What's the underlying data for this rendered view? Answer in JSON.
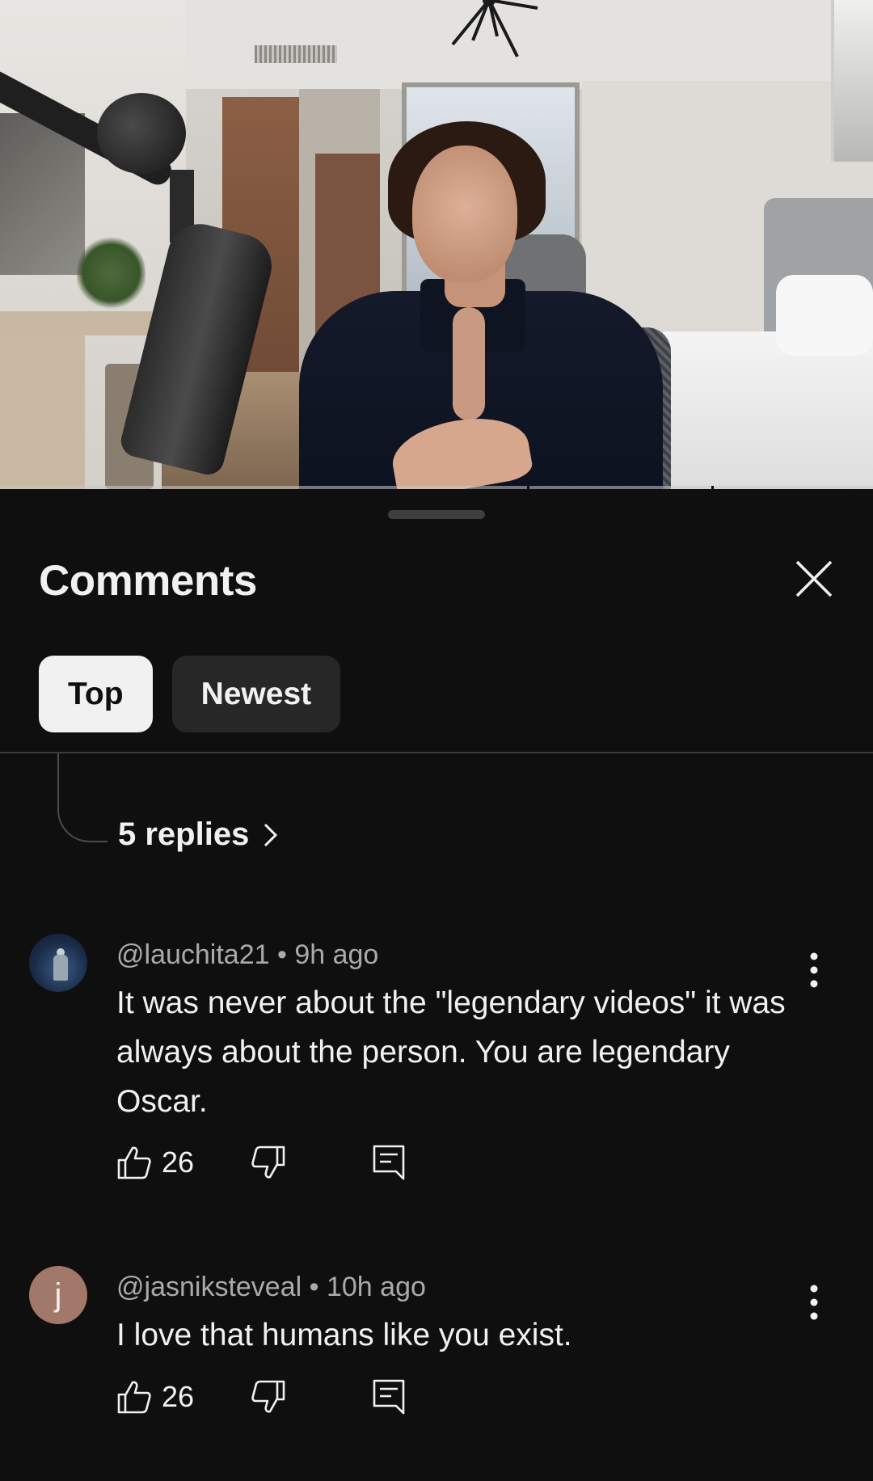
{
  "sheet": {
    "title": "Comments",
    "chips": [
      {
        "label": "Top",
        "active": true
      },
      {
        "label": "Newest",
        "active": false
      }
    ]
  },
  "thread": {
    "replies_label": "5 replies"
  },
  "comments": [
    {
      "handle": "@lauchita21",
      "separator": "•",
      "time": "9h ago",
      "text": "It was never about the \"legendary videos\" it was always about the person. You are legendary Oscar.",
      "likes": "26",
      "avatar_type": "image"
    },
    {
      "handle": "@jasniksteveal",
      "separator": "•",
      "time": "10h ago",
      "text": "I love that humans like you exist.",
      "likes": "26",
      "avatar_type": "letter",
      "avatar_letter": "j",
      "avatar_color": "#a1786a"
    }
  ],
  "icons": {
    "close": "close-icon",
    "chevron": "chevron-right-icon",
    "kebab": "more-vertical-icon",
    "like": "thumbs-up-icon",
    "dislike": "thumbs-down-icon",
    "reply": "reply-comment-icon"
  },
  "colors": {
    "background": "#0f0f0f",
    "chip_active": "#f1f1f1",
    "chip_inactive": "#272727",
    "meta_text": "#aaaaaa"
  }
}
